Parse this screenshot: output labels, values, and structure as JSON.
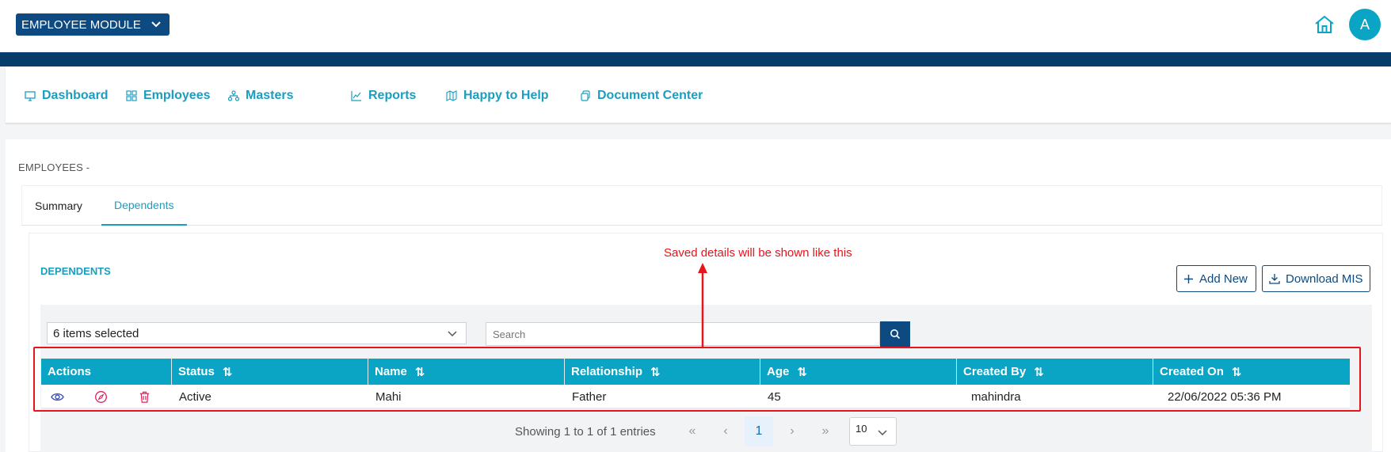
{
  "header": {
    "module_label": "EMPLOYEE MODULE",
    "avatar_initial": "A"
  },
  "nav": {
    "items": [
      {
        "label": "Dashboard",
        "icon": "monitor-icon"
      },
      {
        "label": "Employees",
        "icon": "grid-icon"
      },
      {
        "label": "Masters",
        "icon": "sitemap-icon"
      },
      {
        "label": "Reports",
        "icon": "line-chart-icon"
      },
      {
        "label": "Happy to Help",
        "icon": "map-icon"
      },
      {
        "label": "Document Center",
        "icon": "copy-icon"
      }
    ]
  },
  "page": {
    "section_label": "EMPLOYEES -",
    "tabs": [
      {
        "label": "Summary",
        "active": false
      },
      {
        "label": "Dependents",
        "active": true
      }
    ]
  },
  "panel": {
    "title": "DEPENDENTS",
    "add_new_label": "Add New",
    "download_label": "Download MIS",
    "column_select_value": "6 items selected",
    "search_placeholder": "Search"
  },
  "table": {
    "columns": [
      "Actions",
      "Status",
      "Name",
      "Relationship",
      "Age",
      "Created By",
      "Created On"
    ],
    "rows": [
      {
        "status": "Active",
        "name": "Mahi",
        "relationship": "Father",
        "age": "45",
        "created_by": "mahindra",
        "created_on": "22/06/2022 05:36 PM"
      }
    ]
  },
  "pagination": {
    "info": "Showing 1 to 1 of 1 entries",
    "first": "«",
    "prev": "‹",
    "current_page": "1",
    "next": "›",
    "last": "»",
    "page_size": "10"
  },
  "annotation": {
    "text": "Saved details will be shown like this"
  },
  "colors": {
    "primary_dark": "#0d4a82",
    "accent": "#0aa5c4",
    "annotation_red": "#e8141b"
  }
}
